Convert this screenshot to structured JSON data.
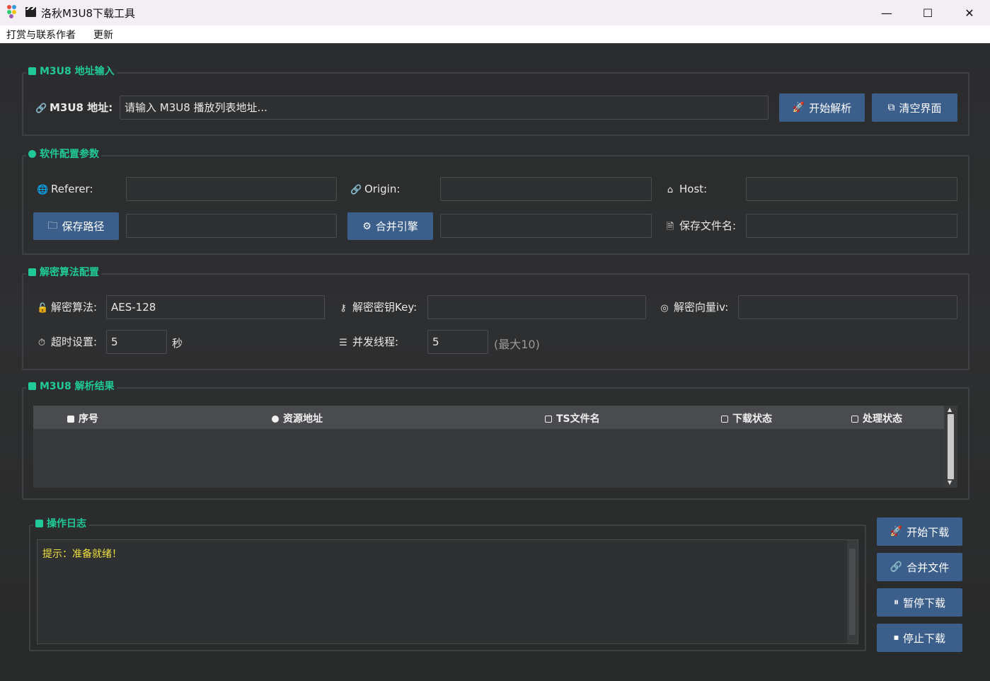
{
  "window": {
    "title": "洛秋M3U8下载工具",
    "controls": {
      "minimize": "—",
      "maximize": "☐",
      "close": "✕"
    }
  },
  "menu": [
    "打赏与联系作者",
    "更新"
  ],
  "colors": {
    "accent_green": "#20c997",
    "button_blue": "#3b5f8a",
    "log_text": "#f0e040"
  },
  "m3u8_input": {
    "group_title": "M3U8 地址输入",
    "label": "M3U8 地址:",
    "placeholder": "请输入 M3U8 播放列表地址...",
    "parse_button": "开始解析",
    "clear_button": "清空界面"
  },
  "config": {
    "group_title": "软件配置参数",
    "referer_label": "Referer:",
    "referer_value": "",
    "origin_label": "Origin:",
    "origin_value": "",
    "host_label": "Host:",
    "host_value": "",
    "save_path_button": "保存路径",
    "save_path_value": "",
    "merge_engine_button": "合并引擎",
    "merge_engine_value": "",
    "filename_label": "保存文件名:",
    "filename_value": ""
  },
  "decrypt": {
    "group_title": "解密算法配置",
    "algo_label": "解密算法:",
    "algo_value": "AES-128",
    "key_label": "解密密钥Key:",
    "key_value": "",
    "iv_label": "解密向量iv:",
    "iv_value": "",
    "timeout_label": "超时设置:",
    "timeout_value": "5",
    "timeout_unit": "秒",
    "threads_label": "并发线程:",
    "threads_value": "5",
    "threads_hint": "(最大10)"
  },
  "results": {
    "group_title": "M3U8 解析结果",
    "columns": [
      "序号",
      "资源地址",
      "TS文件名",
      "下载状态",
      "处理状态"
    ],
    "rows": []
  },
  "log": {
    "group_title": "操作日志",
    "text": "提示：准备就绪！"
  },
  "actions": {
    "start_download": "开始下载",
    "merge_files": "合并文件",
    "pause_download": "暂停下载",
    "stop_download": "停止下载"
  }
}
